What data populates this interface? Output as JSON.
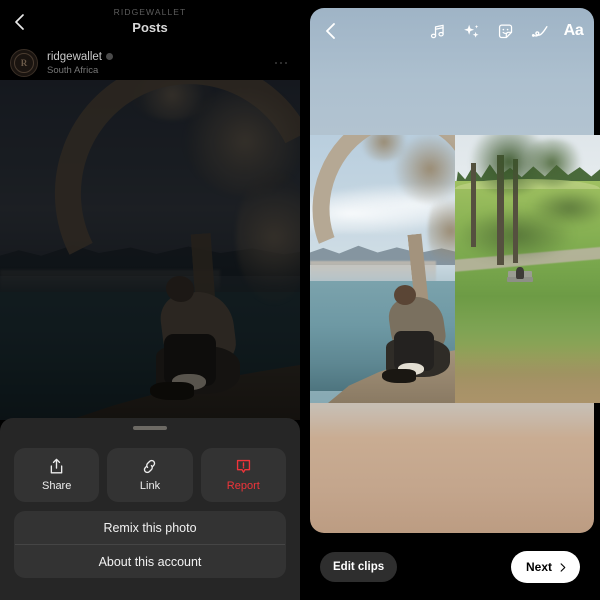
{
  "left_panel": {
    "header": {
      "back_icon": "chevron-left-icon",
      "kicker": "RIDGEWALLET",
      "title": "Posts"
    },
    "account": {
      "avatar_letter": "R",
      "username": "ridgewallet",
      "verified_badge": "verified-icon",
      "location": "South Africa",
      "more_icon": "ellipsis-icon"
    },
    "photo": {
      "alt": "Person sitting under a tree overlooking a coastal bay at dusk"
    },
    "sheet": {
      "grabber": "drag-handle",
      "actions": [
        {
          "id": "share",
          "label": "Share",
          "icon": "share-upload-icon",
          "color": "#ededed"
        },
        {
          "id": "link",
          "label": "Link",
          "icon": "link-chain-icon",
          "color": "#ededed"
        },
        {
          "id": "report",
          "label": "Report",
          "icon": "report-warning-icon",
          "color": "#f0343a"
        }
      ],
      "list": [
        {
          "id": "remix",
          "label": "Remix this photo"
        },
        {
          "id": "about",
          "label": "About this account"
        }
      ]
    }
  },
  "right_panel": {
    "topbar": {
      "back_icon": "chevron-left-icon",
      "tools": [
        {
          "id": "music",
          "icon": "music-note-icon"
        },
        {
          "id": "effects",
          "icon": "sparkles-icon"
        },
        {
          "id": "sticker",
          "icon": "sticker-smiley-icon"
        },
        {
          "id": "draw",
          "icon": "squiggle-draw-icon"
        },
        {
          "id": "text",
          "icon": "text-aa-icon",
          "label": "Aa"
        }
      ]
    },
    "canvas": {
      "media": [
        {
          "id": "clip-1",
          "alt": "Coastal photo with tree and seated person"
        },
        {
          "id": "clip-2",
          "alt": "Park lawn with trees and a bench"
        }
      ]
    },
    "bottom": {
      "edit_clips_label": "Edit clips",
      "next_label": "Next",
      "next_icon": "chevron-right-icon"
    }
  },
  "colors": {
    "accent_red": "#f0343a",
    "sheet_bg": "#262626",
    "card_bg": "#333333",
    "canvas_top": "#adc0cf",
    "canvas_bottom": "#c3a58c",
    "next_bg": "#ffffff"
  }
}
